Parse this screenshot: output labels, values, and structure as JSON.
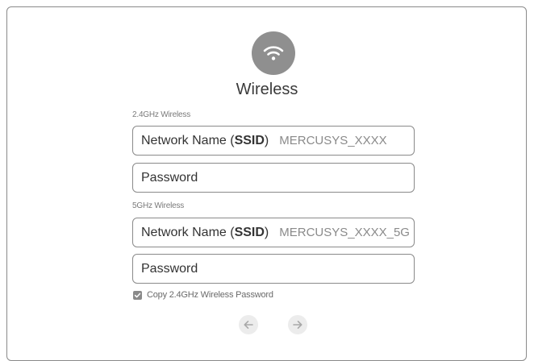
{
  "header": {
    "title": "Wireless",
    "icon": "wifi-icon"
  },
  "band_24": {
    "section_label": "2.4GHz Wireless",
    "ssid_label_prefix": "Network Name (",
    "ssid_label_bold": "SSID",
    "ssid_label_suffix": ")",
    "ssid_value": "MERCUSYS_XXXX",
    "password_label": "Password"
  },
  "band_5": {
    "section_label": "5GHz Wireless",
    "ssid_label_prefix": "Network Name (",
    "ssid_label_bold": "SSID",
    "ssid_label_suffix": ")",
    "ssid_value": "MERCUSYS_XXXX_5G",
    "password_label": "Password"
  },
  "copy_password": {
    "label": "Copy 2.4GHz Wireless Password",
    "checked": true
  },
  "navigation": {
    "back_icon": "arrow-left-icon",
    "next_icon": "arrow-right-icon"
  },
  "colors": {
    "icon_gray": "#8f8f8f",
    "border": "#8a8a8a",
    "nav_bg": "#ececec"
  }
}
